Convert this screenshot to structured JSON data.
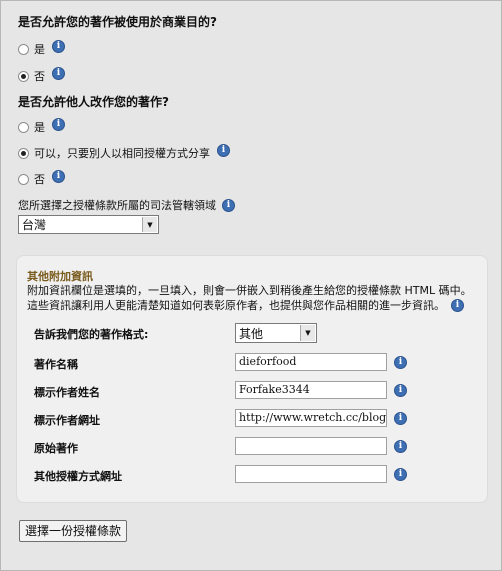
{
  "commercial": {
    "question": "是否允許您的著作被使用於商業目的?",
    "options": [
      {
        "label": "是",
        "checked": false
      },
      {
        "label": "否",
        "checked": true
      }
    ]
  },
  "modification": {
    "question": "是否允許他人改作您的著作?",
    "options": [
      {
        "label": "是",
        "checked": false
      },
      {
        "label": "可以，只要別人以相同授權方式分享",
        "checked": true
      },
      {
        "label": "否",
        "checked": false
      }
    ]
  },
  "jurisdiction": {
    "label": "您所選擇之授權條款所屬的司法管轄領域",
    "selected": "台灣"
  },
  "additional": {
    "title": "其他附加資訊",
    "desc_line1": "附加資訊欄位是選填的，一旦填入，則會一併嵌入到稍後產生給您的授權條款 HTML 碼中。",
    "desc_line2": "這些資訊讓利用人更能清楚知道如何表彰原作者，也提供與您作品相關的進一步資訊。",
    "format_label": "告訴我們您的著作格式:",
    "format_value": "其他",
    "fields": [
      {
        "label": "著作名稱",
        "value": "dieforfood"
      },
      {
        "label": "標示作者姓名",
        "value": "Forfake3344"
      },
      {
        "label": "標示作者網址",
        "value": "http://www.wretch.cc/blog/dief"
      },
      {
        "label": "原始著作",
        "value": ""
      },
      {
        "label": "其他授權方式網址",
        "value": ""
      }
    ]
  },
  "submit_label": "選擇一份授權條款",
  "icons": {
    "info": "info-icon",
    "dropdown": "chevron-down-icon"
  },
  "colors": {
    "info_icon": "#3f6fb3",
    "panel_title": "#7a5c1e"
  }
}
